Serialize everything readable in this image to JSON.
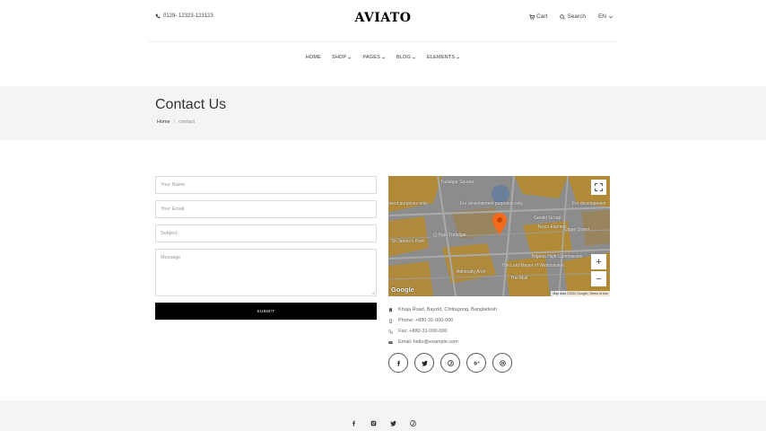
{
  "topbar": {
    "phone": "0129- 12323-123123",
    "logo": "AVIATO",
    "cart": "Cart",
    "search": "Search",
    "lang": "EN"
  },
  "nav": {
    "items": [
      "HOME",
      "SHOP",
      "PAGES",
      "BLOG",
      "ELEMENTS"
    ]
  },
  "header": {
    "title": "Contact Us",
    "breadcrumb_home": "Home",
    "breadcrumb_sep": "/",
    "breadcrumb_current": "contact"
  },
  "form": {
    "name_placeholder": "Your Name",
    "email_placeholder": "Your Email",
    "subject_placeholder": "Subject",
    "message_placeholder": "Message",
    "submit_label": "SUBMIT"
  },
  "map": {
    "labels": {
      "trafalgar": "Trafalgar Square",
      "dev1": "ment purposes only",
      "dev2": "For development purposes only",
      "dev3": "For development",
      "gerald": "Gerald Group",
      "tesco": "Tesco Express",
      "upper": "Upper Street",
      "qpark": "Q-Park Trafalgar",
      "nigeria": "Nigeria High Commission",
      "admiralty": "Admiralty Arch",
      "mall": "The Mall",
      "lord": "The Lord Mayor of Westminster",
      "stjames": "St James's Park"
    },
    "zoom_in": "+",
    "zoom_out": "−",
    "google": "Google",
    "credit": "Map data ©2022 Google  |  Terms of Use"
  },
  "contact": {
    "address": "Khaja Road, Bayzid, Chittagong, Bangladesh",
    "phone": "Phone: +880-31-000-000",
    "fax": "Fax: +880-31-000-000",
    "email": "Email: hello@example.com"
  },
  "colors": {
    "accent": "#000000",
    "map_pin": "#f26a1b",
    "header_bg": "#f4f4f4"
  }
}
